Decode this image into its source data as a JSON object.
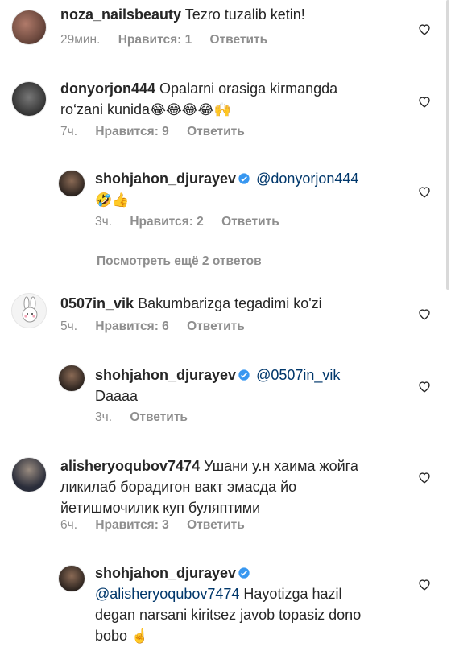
{
  "comments": [
    {
      "username": "noza_nailsbeauty",
      "text": "Tezro tuzalib ketin!",
      "time": "29мин.",
      "likes": "Нравится: 1",
      "reply": "Ответить"
    },
    {
      "username": "donyorjon444",
      "text_line1": "Opalarni orasiga kirmangda",
      "text_line2": "ro‘zani kunida",
      "emojis": "😂😂😂😂🙌",
      "time": "7ч.",
      "likes": "Нравится: 9",
      "reply": "Ответить"
    },
    {
      "username": "shohjahon_djurayev",
      "mention": "@donyorjon444",
      "emojis": "🤣👍",
      "time": "3ч.",
      "likes": "Нравится: 2",
      "reply": "Ответить"
    },
    {
      "username": "0507in_vik",
      "text": "Bakumbarizga tegadimi ko'zi",
      "time": "5ч.",
      "likes": "Нравится: 6",
      "reply": "Ответить"
    },
    {
      "username": "shohjahon_djurayev",
      "mention": "@0507in_vik",
      "text": "Daaaa",
      "time": "3ч.",
      "reply": "Ответить"
    },
    {
      "username": "alisheryoqubov7474",
      "text_line1": "Ушани у.н хаима жойга",
      "text_line2": "ликилаб борадигон вакт эмасда йо",
      "text_line3": "йетишмочилик куп буляптими",
      "time": "6ч.",
      "likes": "Нравится: 3",
      "reply": "Ответить"
    },
    {
      "username": "shohjahon_djurayev",
      "mention": "@alisheryoqubov7474",
      "text_line1": "Hayotizga hazil",
      "text_line2": "degan narsani kiritsez javob topasiz dono",
      "text_line3": "bobo",
      "emojis": "☝️"
    }
  ],
  "more_replies": "Посмотреть ещё 2 ответов",
  "colors": {
    "mention": "#00376b",
    "meta": "#8e8e8e",
    "verified": "#3897f0"
  },
  "icons": [
    "heart-icon",
    "verified-badge-icon"
  ]
}
